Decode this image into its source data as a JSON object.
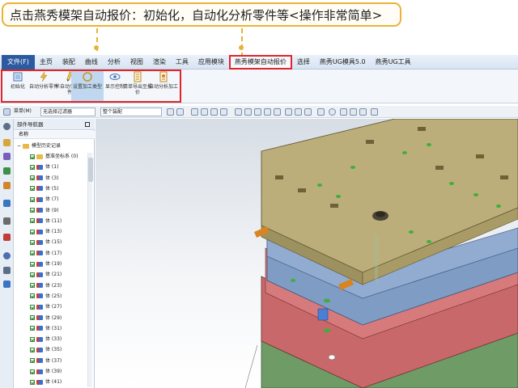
{
  "instruction": "点击燕秀模架自动报价：初始化，自动化分析零件等<操作非常简单>",
  "menubar": {
    "file": "文件(F)",
    "items": [
      "主页",
      "装配",
      "曲线",
      "分析",
      "视图",
      "渲染",
      "工具",
      "应用模块",
      "燕秀模架自动报价",
      "选择",
      "燕秀UG模具5.0",
      "燕秀UG工具"
    ],
    "active_index": 8
  },
  "ribbon": {
    "buttons": [
      {
        "label": "初始化",
        "icon": "init-icon"
      },
      {
        "label": "自动分析零件",
        "icon": "lightning-icon"
      },
      {
        "label": "半自动分析零件",
        "icon": "pencil-icon"
      },
      {
        "label": "设置加工类型",
        "icon": "circle-icon"
      },
      {
        "label": "显示控制",
        "icon": "eye-icon"
      },
      {
        "label": "清单导出至报价",
        "icon": "list-icon"
      },
      {
        "label": "自动分析加工",
        "icon": "analyze-icon"
      }
    ],
    "selected_index": 3
  },
  "toolbar": {
    "menu_label": "菜单(M)",
    "filter": "无选择过滤器",
    "scope": "整个装配"
  },
  "navigator": {
    "title": "部件导航器",
    "column_header": "名称",
    "root": "模型历史记录",
    "items": [
      "基准坐标系 (0)",
      "体 (1)",
      "体 (3)",
      "体 (5)",
      "体 (7)",
      "体 (9)",
      "体 (11)",
      "体 (13)",
      "体 (15)",
      "体 (17)",
      "体 (19)",
      "体 (21)",
      "体 (23)",
      "体 (25)",
      "体 (27)",
      "体 (29)",
      "体 (31)",
      "体 (33)",
      "体 (35)",
      "体 (37)",
      "体 (39)",
      "体 (41)"
    ]
  },
  "colors": {
    "accent_border": "#e0252b",
    "callout_border": "#e9b23a",
    "plate_top": "#bcae7a",
    "plate_blue": "#7e9cc4",
    "plate_red": "#c9686a",
    "plate_green": "#6e9b66"
  }
}
